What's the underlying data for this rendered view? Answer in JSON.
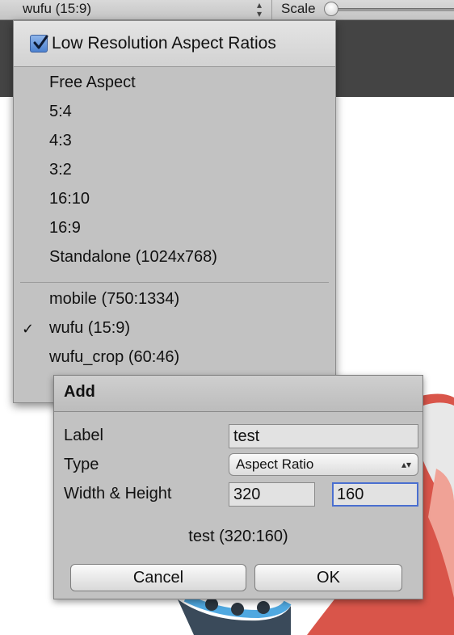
{
  "toolbar": {
    "aspect_value": "wufu (15:9)",
    "scale_label": "Scale"
  },
  "menu": {
    "header_checkbox_label": "Low Resolution Aspect Ratios",
    "header_checked": true,
    "builtin_items": [
      "Free Aspect",
      "5:4",
      "4:3",
      "3:2",
      "16:10",
      "16:9",
      "Standalone (1024x768)"
    ],
    "custom_items": [
      "mobile (750:1334)",
      "wufu (15:9)",
      "wufu_crop (60:46)"
    ],
    "selected_item": "wufu (15:9)",
    "check_glyph": "✓"
  },
  "dialog": {
    "title": "Add",
    "label_label": "Label",
    "label_value": "test",
    "type_label": "Type",
    "type_value": "Aspect Ratio",
    "size_label": "Width & Height",
    "width_value": "320",
    "height_value": "160",
    "preview": "test (320:160)",
    "cancel_label": "Cancel",
    "ok_label": "OK"
  },
  "colors": {
    "accent": "#4a6fd0",
    "panel": "#c2c2c2",
    "dark_band": "#444444"
  }
}
